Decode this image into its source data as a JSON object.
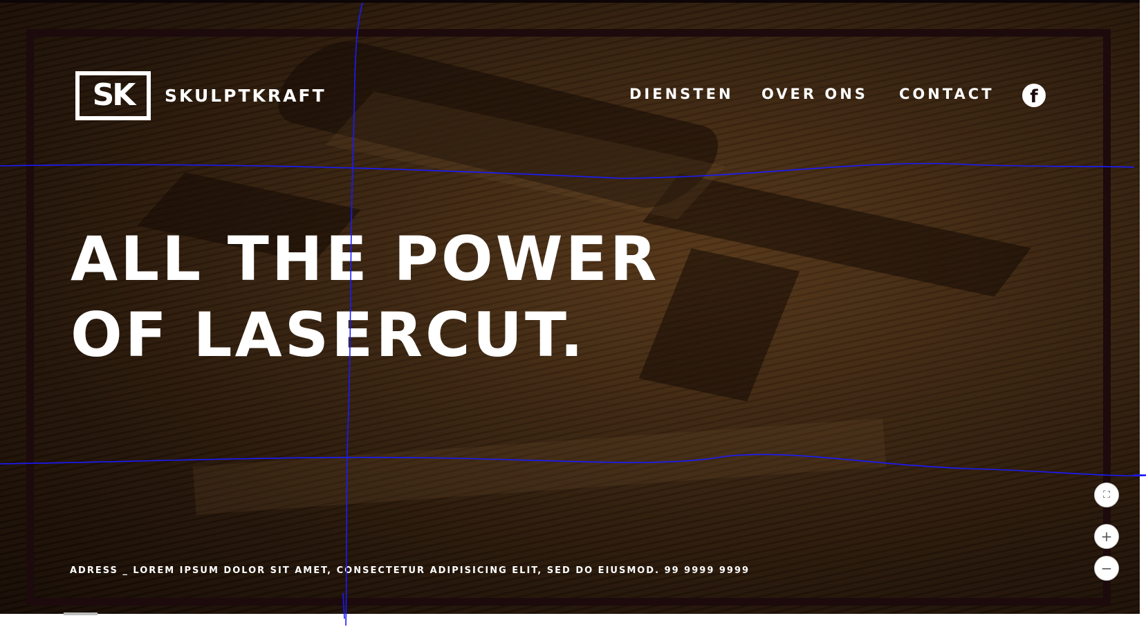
{
  "brand": {
    "logo_mark": "SK",
    "name": "SKULPTKRAFT"
  },
  "nav": {
    "items": [
      {
        "label": "DIENSTEN"
      },
      {
        "label": "OVER ONS"
      },
      {
        "label": "CONTACT"
      }
    ],
    "facebook_glyph": "f"
  },
  "hero": {
    "line1": "ALL THE POWER",
    "line2": "OF LASERCUT."
  },
  "footer": {
    "address": "ADRESS _ LOREM IPSUM DOLOR SIT AMET, CONSECTETUR ADIPISICING ELIT, SED DO EIUSMOD. 99 9999 9999"
  },
  "map_controls": {
    "fullscreen": "⛶",
    "zoom_in": "+",
    "zoom_out": "−"
  },
  "icons": [
    "facebook-icon",
    "fullscreen-icon",
    "zoom-in-icon",
    "zoom-out-icon"
  ],
  "colors": {
    "frame": "#1c0a0c",
    "text": "#ffffff",
    "annotation_line": "#1a1aff"
  }
}
